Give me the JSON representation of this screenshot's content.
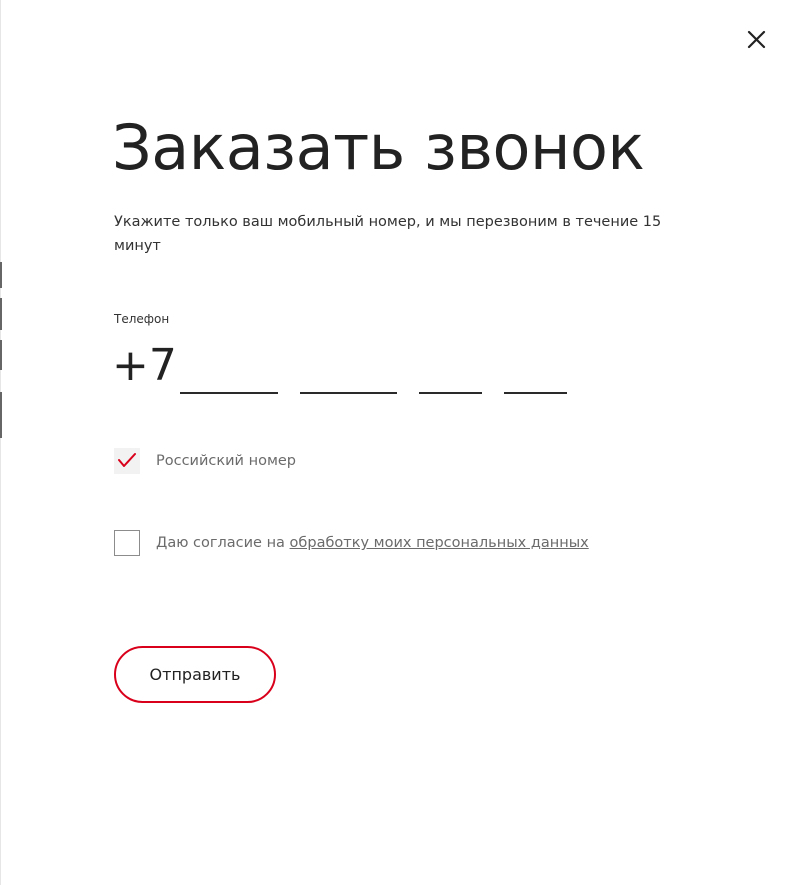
{
  "modal": {
    "title": "Заказать звонок",
    "description": "Укажите только ваш мобильный номер, и мы перезвоним в течение 15 минут",
    "close_icon": "close-icon"
  },
  "phone": {
    "label": "Телефон",
    "prefix": "+7",
    "segments": [
      {
        "value": "",
        "placeholder": ""
      },
      {
        "value": "",
        "placeholder": ""
      },
      {
        "value": "",
        "placeholder": ""
      },
      {
        "value": "",
        "placeholder": ""
      }
    ]
  },
  "options": {
    "russian_number": {
      "label": "Российский номер",
      "checked": true
    },
    "consent": {
      "label_prefix": "Даю согласие на",
      "link_text": "обработку моих персональных данных",
      "checked": false
    }
  },
  "submit": {
    "label": "Отправить"
  },
  "colors": {
    "accent": "#d9001b",
    "text": "#222222",
    "muted_text": "#6b6b6b",
    "background": "#ffffff"
  }
}
